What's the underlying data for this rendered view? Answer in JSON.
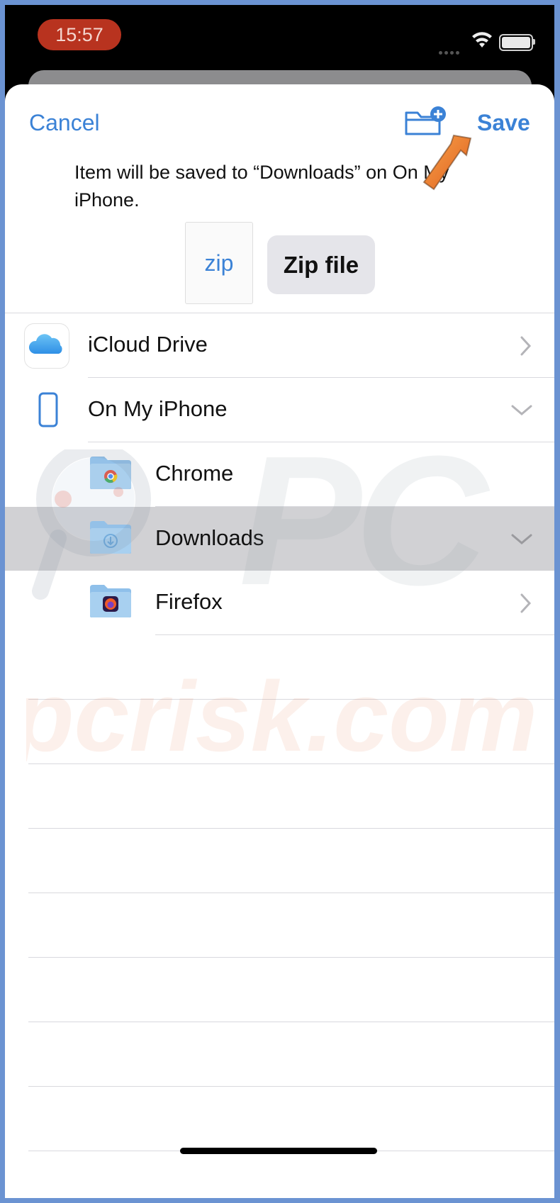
{
  "status": {
    "time": "15:57"
  },
  "header": {
    "cancel_label": "Cancel",
    "save_label": "Save"
  },
  "message": "Item will be saved to “Downloads” on On My iPhone.",
  "file": {
    "thumb_label": "zip",
    "name": "Zip file"
  },
  "locations": [
    {
      "label": "iCloud Drive",
      "chevron": "right"
    },
    {
      "label": "On My iPhone",
      "chevron": "down"
    },
    {
      "label": "Chrome",
      "chevron": "none"
    },
    {
      "label": "Downloads",
      "chevron": "down",
      "selected": true
    },
    {
      "label": "Firefox",
      "chevron": "right"
    }
  ],
  "watermark": "pcrisk.com",
  "colors": {
    "accent": "#3b82d6",
    "selected_row": "#d1d1d4",
    "arrow": "#f07b2a"
  }
}
